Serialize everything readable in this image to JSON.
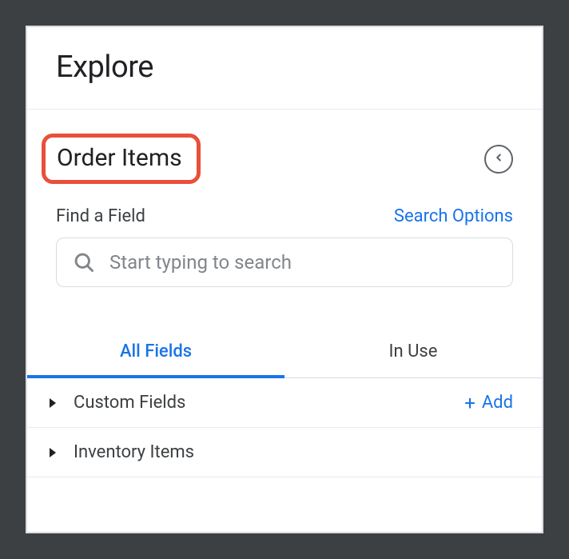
{
  "header": {
    "title": "Explore"
  },
  "section": {
    "title": "Order Items"
  },
  "search": {
    "find_label": "Find a Field",
    "options_label": "Search Options",
    "placeholder": "Start typing to search"
  },
  "tabs": {
    "all_fields": "All Fields",
    "in_use": "In Use"
  },
  "fields": {
    "custom_fields": "Custom Fields",
    "inventory_items": "Inventory Items",
    "add_label": "Add"
  }
}
